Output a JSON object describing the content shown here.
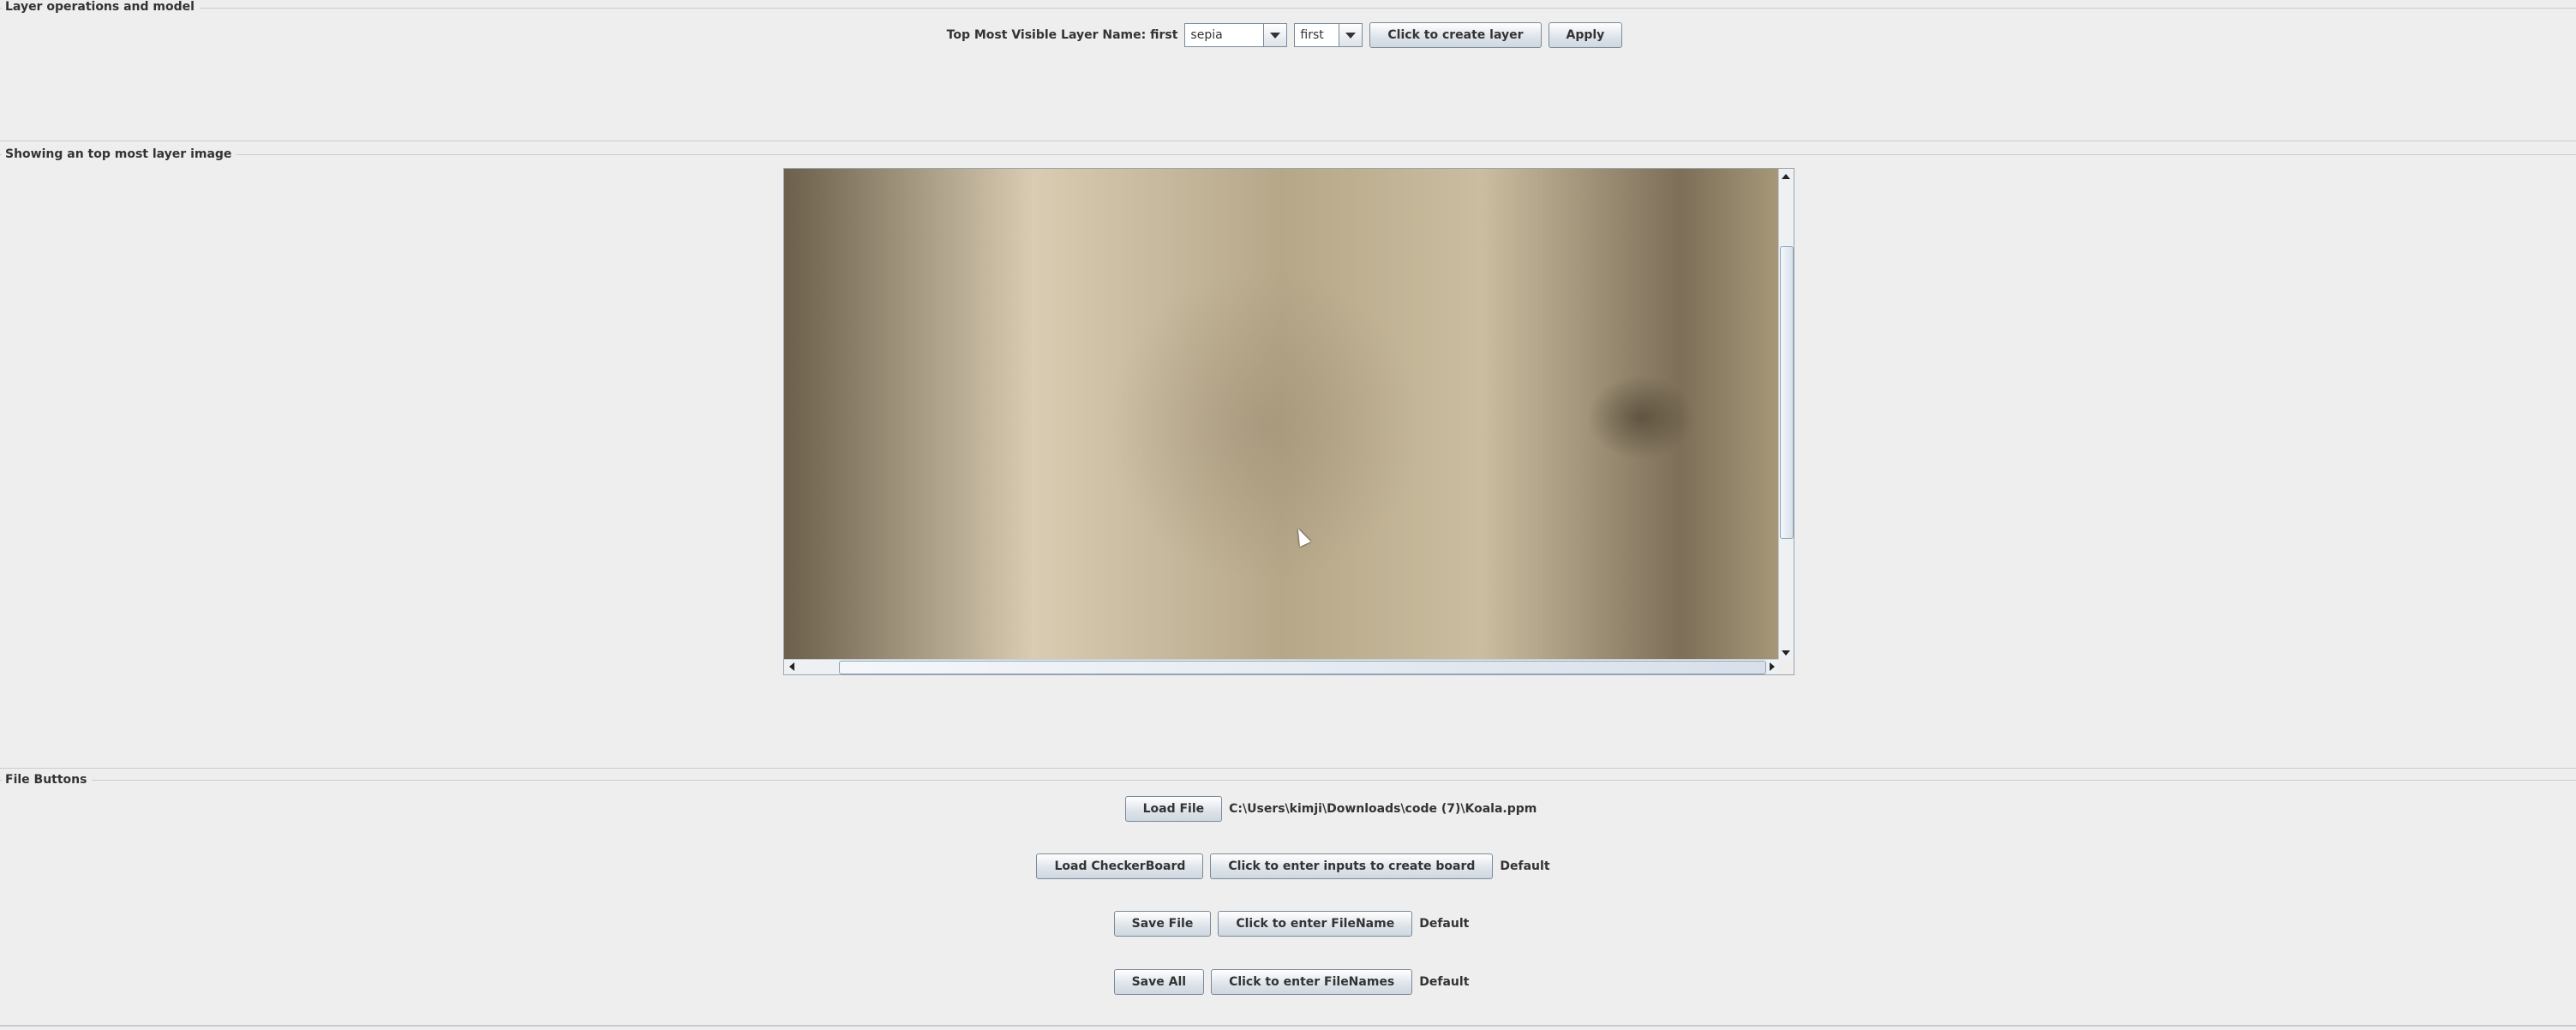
{
  "layer_ops": {
    "title": "Layer operations and model",
    "top_layer_label": "Top Most Visible Layer Name: first",
    "filter_combo_value": "sepia",
    "layer_combo_value": "first",
    "create_layer_button": "Click to create layer",
    "apply_button": "Apply"
  },
  "image_panel": {
    "title": "Showing an top most layer image",
    "image_description": "sepia koala photo"
  },
  "file_buttons": {
    "title": "File Buttons",
    "load_file_button": "Load File",
    "load_file_path": "C:\\Users\\kimji\\Downloads\\code (7)\\Koala.ppm",
    "load_checkerboard_button": "Load CheckerBoard",
    "checkerboard_inputs_button": "Click to enter inputs to create board",
    "checkerboard_status": "Default",
    "save_file_button": "Save File",
    "save_filename_button": "Click to enter FileName",
    "save_file_status": "Default",
    "save_all_button": "Save All",
    "save_all_filenames_button": "Click to enter FileNames",
    "save_all_status": "Default"
  },
  "colors": {
    "background": "#eeeeee",
    "border": "#c8ccd2",
    "button_border": "#7a8a99"
  }
}
